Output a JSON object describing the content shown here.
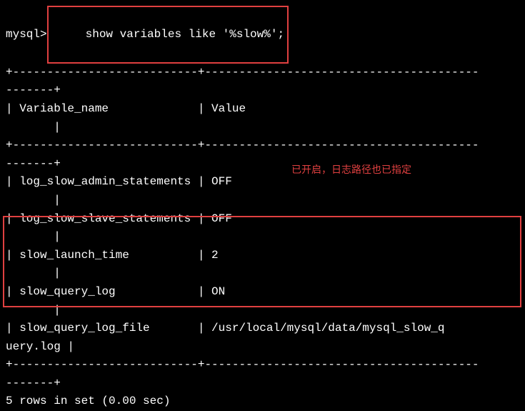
{
  "prompt": "mysql>",
  "command": " show variables like '%slow%';",
  "separator1": "+---------------------------+----------------------------------------",
  "separator1b": "-------+",
  "header_row": "| Variable_name             | Value                                  ",
  "header_row_b": "       |",
  "separator2": "+---------------------------+----------------------------------------",
  "separator2b": "-------+",
  "rows": [
    {
      "text": "| log_slow_admin_statements | OFF                                    ",
      "tail": "       |"
    },
    {
      "text": "| log_slow_slave_statements | OFF                                    ",
      "tail": "       |"
    },
    {
      "text": "| slow_launch_time          | 2                                      ",
      "tail": "       |"
    },
    {
      "text": "| slow_query_log            | ON                                     ",
      "tail": "       |"
    },
    {
      "text": "| slow_query_log_file       | /usr/local/mysql/data/mysql_slow_q",
      "tail": "uery.log |"
    }
  ],
  "separator3": "+---------------------------+----------------------------------------",
  "separator3b": "-------+",
  "footer": "5 rows in set (0.00 sec)",
  "annotation_text": "已开启，日志路径也已指定",
  "chart_data": {
    "type": "table",
    "columns": [
      "Variable_name",
      "Value"
    ],
    "rows": [
      [
        "log_slow_admin_statements",
        "OFF"
      ],
      [
        "log_slow_slave_statements",
        "OFF"
      ],
      [
        "slow_launch_time",
        "2"
      ],
      [
        "slow_query_log",
        "ON"
      ],
      [
        "slow_query_log_file",
        "/usr/local/mysql/data/mysql_slow_query.log"
      ]
    ]
  }
}
